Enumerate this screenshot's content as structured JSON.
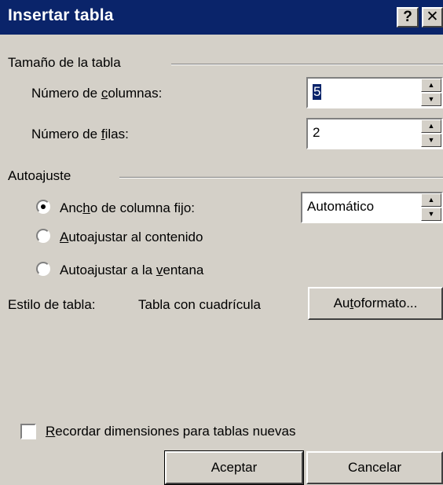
{
  "window": {
    "title": "Insertar tabla",
    "help_label": "?",
    "close_label": "✕"
  },
  "table_size": {
    "group_label": "Tamaño de la tabla",
    "columns": {
      "label_pre": "Número de ",
      "label_key": "c",
      "label_post": "olumnas:",
      "value": "5"
    },
    "rows": {
      "label_pre": "Número de ",
      "label_key": "f",
      "label_post": "ilas:",
      "value": "2"
    }
  },
  "autofit": {
    "group_label": "Autoajuste",
    "fixed_width": {
      "label_pre": "Anc",
      "label_key": "h",
      "label_post": "o de columna fijo:",
      "selected": true,
      "value": "Automático"
    },
    "fit_contents": {
      "label_pre": "",
      "label_key": "A",
      "label_post": "utoajustar al contenido",
      "selected": false
    },
    "fit_window": {
      "label_pre": "Autoajustar a la ",
      "label_key": "v",
      "label_post": "entana",
      "selected": false
    }
  },
  "style": {
    "label": "Estilo de tabla:",
    "value": "Tabla con cuadrícula",
    "autoformat": {
      "pre": "Au",
      "key": "t",
      "post": "oformato..."
    }
  },
  "remember": {
    "label_pre": "",
    "label_key": "R",
    "label_post": "ecordar dimensiones para tablas nuevas",
    "checked": false
  },
  "buttons": {
    "ok": "Aceptar",
    "cancel": "Cancelar"
  },
  "colors": {
    "titlebar": "#0a246a",
    "dialog_bg": "#d4d0c8"
  }
}
